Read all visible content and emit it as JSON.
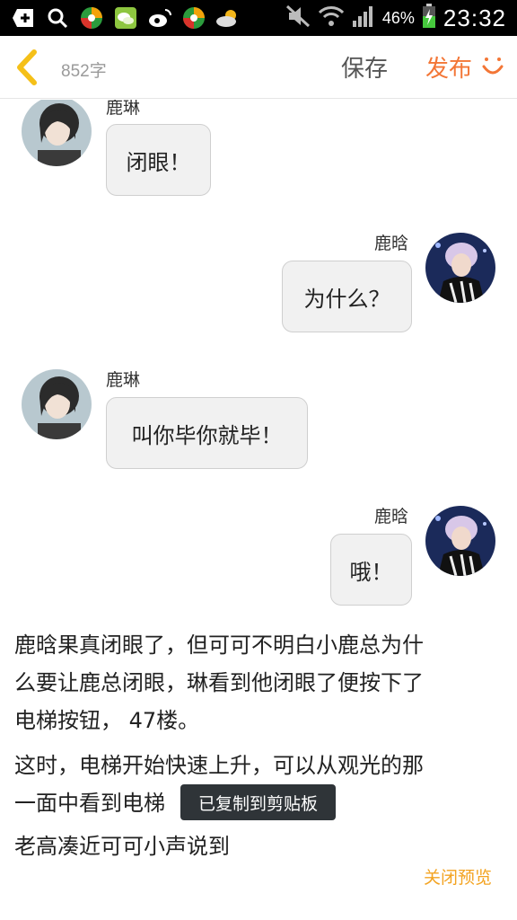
{
  "status_bar": {
    "battery_percent": "46%",
    "time": "23:32",
    "icons": [
      "plus-box-icon",
      "search-icon",
      "app-icon-1",
      "wechat-icon",
      "weibo-icon",
      "app-icon-2",
      "weather-icon",
      "mute-icon",
      "wifi-icon",
      "signal-icon",
      "battery-charging-icon"
    ]
  },
  "header": {
    "word_count": "852字",
    "save_label": "保存",
    "publish_label": "发布",
    "accent_color": "#f37636"
  },
  "chat": [
    {
      "side": "left",
      "name": "鹿琳",
      "text": "闭眼！"
    },
    {
      "side": "right",
      "name": "鹿晗",
      "text": "为什么？"
    },
    {
      "side": "left",
      "name": "鹿琳",
      "text": "叫你毕你就毕！"
    },
    {
      "side": "right",
      "name": "鹿晗",
      "text": "哦！"
    }
  ],
  "paragraphs": {
    "p1_line1": "鹿晗果真闭眼了，但可可不明白小鹿总为什",
    "p1_line2": "么要让鹿总闭眼，琳看到他闭眼了便按下了",
    "p1_line3": "电梯按钮， 47楼。",
    "p2_line1": "这时，电梯开始快速上升，可以从观光的那",
    "p2_line2": "一面中看到电梯",
    "p2_line2_tail": "。",
    "p3_line1": "老高凑近可可小声说到"
  },
  "toast": "已复制到剪贴板",
  "close_preview": "关闭预览"
}
